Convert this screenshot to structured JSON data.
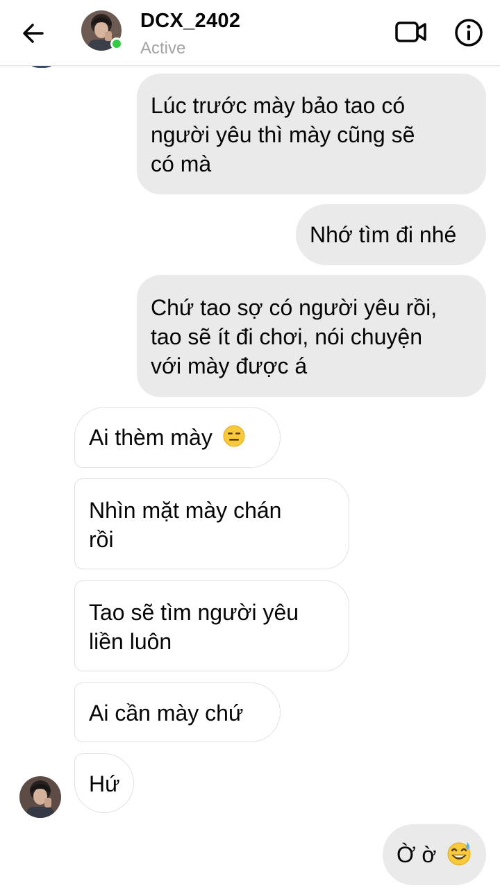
{
  "header": {
    "contact_name": "DCX_2402",
    "status": "Active"
  },
  "colors": {
    "online": "#31cc46",
    "outgoing_bubble": "#eaeaea",
    "incoming_border": "#e1e1e1",
    "status_text": "#a3a3a3"
  },
  "icons": {
    "back": "back-arrow-icon",
    "video": "video-camera-icon",
    "info": "info-icon",
    "emoji_expressionless": "expressionless-face-emoji",
    "emoji_sweat": "grinning-face-with-sweat-emoji"
  },
  "messages": [
    {
      "direction": "outgoing",
      "lines": [
        "Lúc trước mày bảo tao có",
        "người yêu thì mày cũng sẽ",
        "có mà"
      ]
    },
    {
      "direction": "outgoing",
      "lines": [
        "Nhớ tìm đi nhé"
      ]
    },
    {
      "direction": "outgoing",
      "lines": [
        "Chứ tao sợ có người yêu rồi,",
        "tao sẽ ít đi chơi, nói chuyện",
        "với mày được á"
      ]
    },
    {
      "direction": "incoming",
      "lines": [
        "Ai thèm mày"
      ],
      "emoji": "expressionless-face-emoji"
    },
    {
      "direction": "incoming",
      "lines": [
        "Nhìn mặt mày chán",
        "rồi"
      ]
    },
    {
      "direction": "incoming",
      "lines": [
        "Tao sẽ tìm người yêu",
        "liền luôn"
      ]
    },
    {
      "direction": "incoming",
      "lines": [
        "Ai cần mày chứ"
      ]
    },
    {
      "direction": "incoming",
      "lines": [
        "Hứ"
      ]
    },
    {
      "direction": "outgoing",
      "lines": [
        "Ờ ờ"
      ],
      "emoji": "grinning-face-with-sweat-emoji"
    }
  ]
}
